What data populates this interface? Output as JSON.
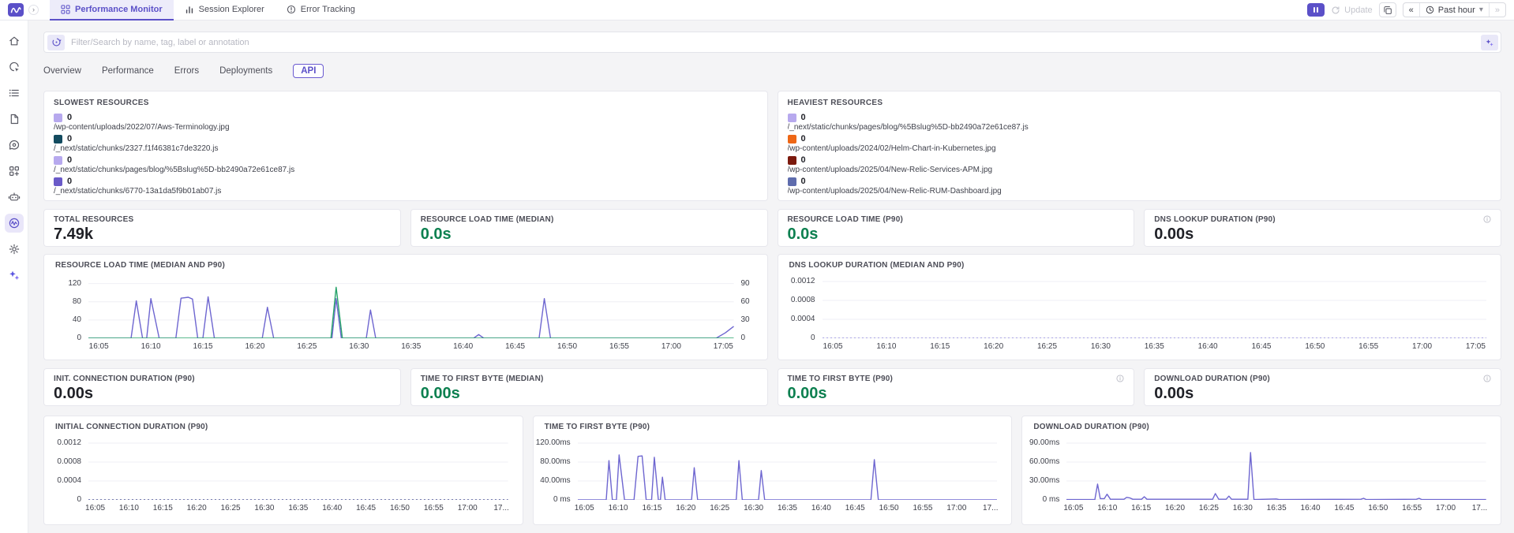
{
  "colors": {
    "accent_purple": "#5b50c8",
    "accent_green": "#0d8050",
    "series_purple": "#6e66d0",
    "series_green": "#27a36a"
  },
  "topbar": {
    "product_tabs": [
      {
        "label": "Performance Monitor",
        "icon": "grid-icon",
        "active": true
      },
      {
        "label": "Session Explorer",
        "icon": "bar-chart-icon",
        "active": false
      },
      {
        "label": "Error Tracking",
        "icon": "error-circle-icon",
        "active": false
      }
    ],
    "controls": {
      "update_label": "Update",
      "time_range_label": "Past hour"
    }
  },
  "sidebar": {
    "items": [
      "home-icon",
      "browser-icon",
      "logs-icon",
      "document-icon",
      "chat-icon",
      "dashboards-icon",
      "bot-icon",
      "rum-icon",
      "settings-icon",
      "ai-sparkle-icon"
    ],
    "active_item": "rum-icon"
  },
  "search": {
    "placeholder": "Filter/Search by name, tag, label or annotation"
  },
  "view_tabs": {
    "items": [
      "Overview",
      "Performance",
      "Errors",
      "Deployments",
      "API"
    ],
    "active": "API"
  },
  "slowest_resources": {
    "title": "SLOWEST RESOURCES",
    "items": [
      {
        "value": "0",
        "color": "#b7a9ee",
        "path": "/wp-content/uploads/2022/07/Aws-Terminology.jpg"
      },
      {
        "value": "0",
        "color": "#134b5f",
        "path": "/_next/static/chunks/2327.f1f46381c7de3220.js"
      },
      {
        "value": "0",
        "color": "#b7a9ee",
        "path": "/_next/static/chunks/pages/blog/%5Bslug%5D-bb2490a72e61ce87.js"
      },
      {
        "value": "0",
        "color": "#6a5ac8",
        "path": "/_next/static/chunks/6770-13a1da5f9b01ab07.js"
      }
    ]
  },
  "heaviest_resources": {
    "title": "HEAVIEST RESOURCES",
    "items": [
      {
        "value": "0",
        "color": "#b7a9ee",
        "path": "/_next/static/chunks/pages/blog/%5Bslug%5D-bb2490a72e61ce87.js"
      },
      {
        "value": "0",
        "color": "#ee6716",
        "path": "/wp-content/uploads/2024/02/Helm-Chart-in-Kubernetes.jpg"
      },
      {
        "value": "0",
        "color": "#7c1a0e",
        "path": "/wp-content/uploads/2025/04/New-Relic-Services-APM.jpg"
      },
      {
        "value": "0",
        "color": "#5e6cad",
        "path": "/wp-content/uploads/2025/04/New-Relic-RUM-Dashboard.jpg"
      }
    ]
  },
  "metrics": {
    "row1": [
      {
        "title": "TOTAL RESOURCES",
        "value": "7.49k",
        "accent": "dark",
        "info": false
      },
      {
        "title": "RESOURCE LOAD TIME (MEDIAN)",
        "value": "0.0s",
        "accent": "green",
        "info": false
      },
      {
        "title": "RESOURCE LOAD TIME (P90)",
        "value": "0.0s",
        "accent": "green",
        "info": false
      },
      {
        "title": "DNS LOOKUP DURATION (P90)",
        "value": "0.00s",
        "accent": "dark",
        "info": true
      }
    ],
    "row2": [
      {
        "title": "INIT. CONNECTION DURATION (P90)",
        "value": "0.00s",
        "accent": "dark",
        "info": false
      },
      {
        "title": "TIME TO FIRST BYTE (MEDIAN)",
        "value": "0.00s",
        "accent": "green",
        "info": false
      },
      {
        "title": "TIME TO FIRST BYTE (P90)",
        "value": "0.00s",
        "accent": "green",
        "info": true
      },
      {
        "title": "DOWNLOAD DURATION (P90)",
        "value": "0.00s",
        "accent": "dark",
        "info": true
      }
    ]
  },
  "chart_data": [
    {
      "id": "resource-load-time",
      "type": "line",
      "title": "RESOURCE LOAD TIME (MEDIAN AND P90)",
      "x_domain": [
        4,
        66
      ],
      "y_max": 135,
      "x_ticks": {
        "values": [
          5,
          10,
          15,
          20,
          25,
          30,
          35,
          40,
          45,
          50,
          55,
          60,
          65
        ],
        "labels": [
          "16:05",
          "16:10",
          "16:15",
          "16:20",
          "16:25",
          "16:30",
          "16:35",
          "16:40",
          "16:45",
          "16:50",
          "16:55",
          "17:00",
          "17:05"
        ]
      },
      "y_left": {
        "values": [
          120,
          80,
          40,
          0
        ],
        "labels": [
          "120",
          "80",
          "40",
          "0"
        ]
      },
      "y_right": {
        "values": [
          120,
          80,
          40,
          0
        ],
        "labels": [
          "90",
          "60",
          "30",
          "0"
        ]
      },
      "series": [
        {
          "name": "p90",
          "color": "#6e66d0",
          "points": [
            [
              4,
              0
            ],
            [
              8.1,
              0
            ],
            [
              8.6,
              82
            ],
            [
              9.2,
              0
            ],
            [
              9.6,
              0
            ],
            [
              10.0,
              87
            ],
            [
              10.8,
              0
            ],
            [
              12.4,
              0
            ],
            [
              12.9,
              88
            ],
            [
              13.6,
              90
            ],
            [
              14.0,
              86
            ],
            [
              14.5,
              0
            ],
            [
              15.0,
              0
            ],
            [
              15.5,
              91
            ],
            [
              16.1,
              0
            ],
            [
              20.7,
              0
            ],
            [
              21.2,
              68
            ],
            [
              21.8,
              0
            ],
            [
              27.4,
              0
            ],
            [
              27.8,
              87
            ],
            [
              28.3,
              0
            ],
            [
              30.7,
              0
            ],
            [
              31.1,
              62
            ],
            [
              31.6,
              0
            ],
            [
              41.0,
              0
            ],
            [
              41.5,
              8
            ],
            [
              42.0,
              0
            ],
            [
              47.3,
              0
            ],
            [
              47.8,
              87
            ],
            [
              48.4,
              0
            ],
            [
              64.3,
              0
            ],
            [
              65.2,
              12
            ],
            [
              66,
              26
            ]
          ]
        },
        {
          "name": "median",
          "color": "#27a36a",
          "points": [
            [
              4,
              0
            ],
            [
              27.3,
              0
            ],
            [
              27.8,
              112
            ],
            [
              28.4,
              0
            ],
            [
              66,
              0
            ]
          ]
        }
      ]
    },
    {
      "id": "dns-lookup-duration",
      "type": "line",
      "title": "DNS LOOKUP DURATION (MEDIAN AND P90)",
      "x_domain": [
        4,
        66
      ],
      "y_max": 0.0013,
      "x_ticks": {
        "values": [
          5,
          10,
          15,
          20,
          25,
          30,
          35,
          40,
          45,
          50,
          55,
          60,
          65
        ],
        "labels": [
          "16:05",
          "16:10",
          "16:15",
          "16:20",
          "16:25",
          "16:30",
          "16:35",
          "16:40",
          "16:45",
          "16:50",
          "16:55",
          "17:00",
          "17:05"
        ]
      },
      "y_left": {
        "values": [
          0.0012,
          0.0008,
          0.0004,
          0
        ],
        "labels": [
          "0.0012",
          "0.0008",
          "0.0004",
          "0"
        ]
      },
      "series": [
        {
          "name": "median-p90",
          "color": "#8f8ade",
          "dash": "2 3",
          "points": [
            [
              4,
              0
            ],
            [
              66,
              0
            ]
          ]
        }
      ]
    },
    {
      "id": "initial-connection-duration",
      "type": "line",
      "title": "INITIAL CONNECTION DURATION (P90)",
      "x_domain": [
        4,
        66
      ],
      "y_max": 0.0013,
      "x_ticks": {
        "values": [
          5,
          10,
          15,
          20,
          25,
          30,
          35,
          40,
          45,
          50,
          55,
          60,
          65
        ],
        "labels": [
          "16:05",
          "16:10",
          "16:15",
          "16:20",
          "16:25",
          "16:30",
          "16:35",
          "16:40",
          "16:45",
          "16:50",
          "16:55",
          "17:00",
          "17..."
        ]
      },
      "y_left": {
        "values": [
          0.0012,
          0.0008,
          0.0004,
          0
        ],
        "labels": [
          "0.0012",
          "0.0008",
          "0.0004",
          "0"
        ]
      },
      "series": [
        {
          "name": "p90",
          "color": "#4a5296",
          "dash": "2 3",
          "points": [
            [
              4,
              0
            ],
            [
              66,
              0
            ]
          ]
        }
      ]
    },
    {
      "id": "time-to-first-byte-p90",
      "type": "line",
      "title": "TIME TO FIRST BYTE (P90)",
      "x_domain": [
        4,
        66
      ],
      "y_max": 130,
      "x_ticks": {
        "values": [
          5,
          10,
          15,
          20,
          25,
          30,
          35,
          40,
          45,
          50,
          55,
          60,
          65
        ],
        "labels": [
          "16:05",
          "16:10",
          "16:15",
          "16:20",
          "16:25",
          "16:30",
          "16:35",
          "16:40",
          "16:45",
          "16:50",
          "16:55",
          "17:00",
          "17..."
        ]
      },
      "y_left": {
        "values": [
          120,
          80,
          40,
          0
        ],
        "labels": [
          "120.00ms",
          "80.00ms",
          "40.00ms",
          "0 ms"
        ]
      },
      "series": [
        {
          "name": "p90",
          "color": "#6e66d0",
          "points": [
            [
              4,
              0
            ],
            [
              8.2,
              0
            ],
            [
              8.6,
              83
            ],
            [
              9.1,
              0
            ],
            [
              9.7,
              0
            ],
            [
              10.1,
              95
            ],
            [
              10.9,
              0
            ],
            [
              12.3,
              0
            ],
            [
              12.9,
              92
            ],
            [
              13.5,
              93
            ],
            [
              14.1,
              0
            ],
            [
              14.9,
              0
            ],
            [
              15.3,
              90
            ],
            [
              15.9,
              0
            ],
            [
              16.2,
              0
            ],
            [
              16.5,
              48
            ],
            [
              16.9,
              0
            ],
            [
              20.8,
              0
            ],
            [
              21.2,
              68
            ],
            [
              21.7,
              0
            ],
            [
              27.4,
              0
            ],
            [
              27.8,
              83
            ],
            [
              28.3,
              0
            ],
            [
              30.7,
              0
            ],
            [
              31.1,
              62
            ],
            [
              31.6,
              0
            ],
            [
              47.3,
              0
            ],
            [
              47.8,
              85
            ],
            [
              48.4,
              0
            ],
            [
              66,
              0
            ]
          ]
        }
      ]
    },
    {
      "id": "download-duration-p90",
      "type": "line",
      "title": "DOWNLOAD DURATION (P90)",
      "x_domain": [
        4,
        66
      ],
      "y_max": 97.5,
      "x_ticks": {
        "values": [
          5,
          10,
          15,
          20,
          25,
          30,
          35,
          40,
          45,
          50,
          55,
          60,
          65
        ],
        "labels": [
          "16:05",
          "16:10",
          "16:15",
          "16:20",
          "16:25",
          "16:30",
          "16:35",
          "16:40",
          "16:45",
          "16:50",
          "16:55",
          "17:00",
          "17..."
        ]
      },
      "y_left": {
        "values": [
          90,
          60,
          30,
          0
        ],
        "labels": [
          "90.00ms",
          "60.00ms",
          "30.00ms",
          "0 ms"
        ]
      },
      "series": [
        {
          "name": "p90",
          "color": "#6e66d0",
          "points": [
            [
              4,
              0.5
            ],
            [
              8.2,
              0.5
            ],
            [
              8.6,
              25
            ],
            [
              9.0,
              2
            ],
            [
              9.6,
              2
            ],
            [
              10.0,
              9
            ],
            [
              10.5,
              1
            ],
            [
              12.5,
              1
            ],
            [
              12.9,
              4
            ],
            [
              13.4,
              3
            ],
            [
              13.8,
              1
            ],
            [
              15.1,
              1
            ],
            [
              15.5,
              5
            ],
            [
              15.9,
              1
            ],
            [
              25.6,
              1
            ],
            [
              26.0,
              10
            ],
            [
              26.5,
              1
            ],
            [
              27.6,
              1
            ],
            [
              28.0,
              6
            ],
            [
              28.4,
              1
            ],
            [
              30.8,
              1
            ],
            [
              31.2,
              75
            ],
            [
              31.7,
              0.5
            ],
            [
              35.0,
              1.5
            ],
            [
              35.4,
              0.5
            ],
            [
              47.5,
              1
            ],
            [
              47.9,
              2.5
            ],
            [
              48.3,
              0.5
            ],
            [
              55.7,
              1
            ],
            [
              56.1,
              2.5
            ],
            [
              56.5,
              0.5
            ],
            [
              66,
              0.5
            ]
          ]
        }
      ]
    }
  ]
}
